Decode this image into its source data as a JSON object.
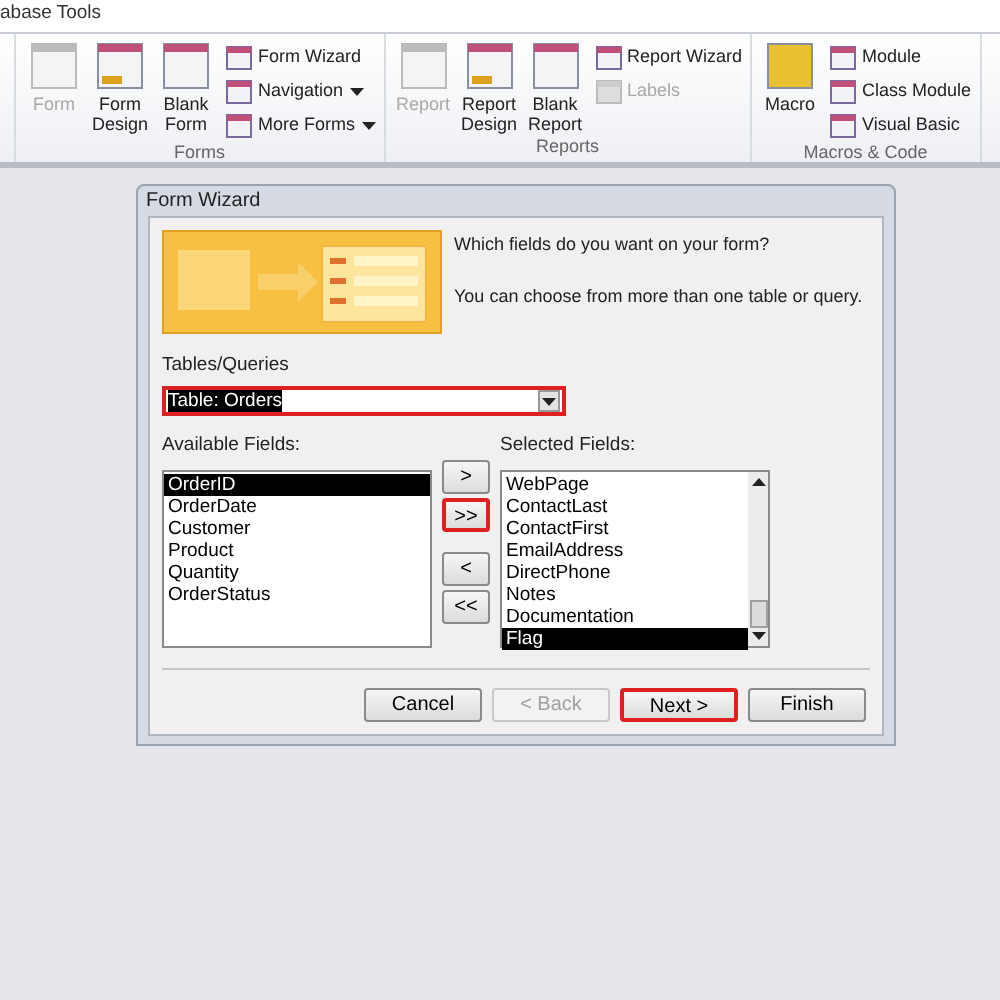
{
  "ribbon": {
    "tab": "abase Tools",
    "groups": [
      {
        "name": "Forms",
        "large": [
          {
            "label": "Form",
            "disabled": true
          },
          {
            "label": "Form Design",
            "disabled": false
          },
          {
            "label": "Blank Form",
            "disabled": false
          }
        ],
        "small": [
          {
            "label": "Form Wizard",
            "dropdown": false,
            "disabled": false
          },
          {
            "label": "Navigation",
            "dropdown": true,
            "disabled": false
          },
          {
            "label": "More Forms",
            "dropdown": true,
            "disabled": false
          }
        ]
      },
      {
        "name": "Reports",
        "large": [
          {
            "label": "Report",
            "disabled": true
          },
          {
            "label": "Report Design",
            "disabled": false
          },
          {
            "label": "Blank Report",
            "disabled": false
          }
        ],
        "small": [
          {
            "label": "Report Wizard",
            "dropdown": false,
            "disabled": false
          },
          {
            "label": "Labels",
            "dropdown": false,
            "disabled": true
          }
        ]
      },
      {
        "name": "Macros & Code",
        "large": [
          {
            "label": "Macro",
            "disabled": false
          }
        ],
        "small": [
          {
            "label": "Module",
            "dropdown": false,
            "disabled": false
          },
          {
            "label": "Class Module",
            "dropdown": false,
            "disabled": false
          },
          {
            "label": "Visual Basic",
            "dropdown": false,
            "disabled": false
          }
        ]
      }
    ]
  },
  "dialog": {
    "title": "Form Wizard",
    "question": "Which fields do you want on your form?",
    "hint": "You can choose from more than one table or query.",
    "tables_label": "Tables/Queries",
    "tables_value": "Table: Orders",
    "tables_highlighted": true,
    "available_label": "Available Fields:",
    "available": [
      {
        "label": "OrderID",
        "selected": true
      },
      {
        "label": "OrderDate",
        "selected": false
      },
      {
        "label": "Customer",
        "selected": false
      },
      {
        "label": "Product",
        "selected": false
      },
      {
        "label": "Quantity",
        "selected": false
      },
      {
        "label": "OrderStatus",
        "selected": false
      }
    ],
    "move_buttons": [
      {
        "label": ">",
        "disabled": false,
        "highlighted": false
      },
      {
        "label": ">>",
        "disabled": false,
        "highlighted": true
      },
      {
        "label": "<",
        "disabled": false,
        "highlighted": false
      },
      {
        "label": "<<",
        "disabled": false,
        "highlighted": false
      }
    ],
    "selected_label": "Selected Fields:",
    "selected_fields": [
      {
        "label": "WebPage",
        "selected": false
      },
      {
        "label": "ContactLast",
        "selected": false
      },
      {
        "label": "ContactFirst",
        "selected": false
      },
      {
        "label": "EmailAddress",
        "selected": false
      },
      {
        "label": "DirectPhone",
        "selected": false
      },
      {
        "label": "Notes",
        "selected": false
      },
      {
        "label": "Documentation",
        "selected": false
      },
      {
        "label": "Flag",
        "selected": true
      }
    ],
    "buttons": [
      {
        "label": "Cancel",
        "disabled": false,
        "highlighted": false
      },
      {
        "label": "< Back",
        "disabled": true,
        "highlighted": false
      },
      {
        "label": "Next >",
        "disabled": false,
        "highlighted": true
      },
      {
        "label": "Finish",
        "disabled": false,
        "highlighted": false
      }
    ]
  }
}
